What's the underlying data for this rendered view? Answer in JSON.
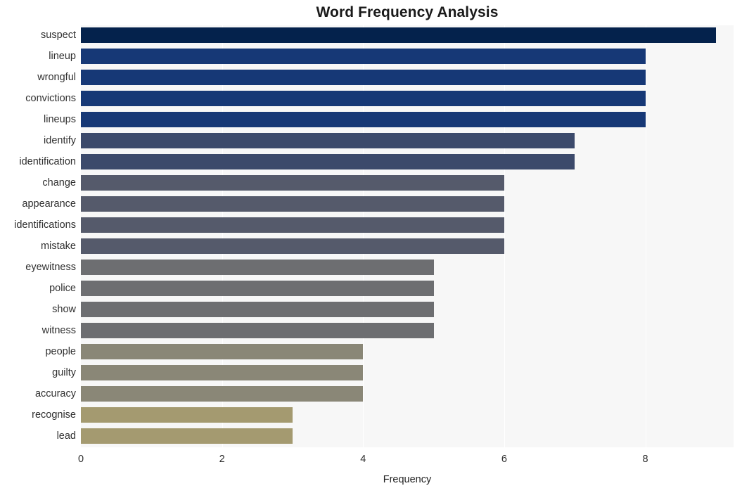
{
  "chart_data": {
    "type": "bar",
    "orientation": "horizontal",
    "title": "Word Frequency Analysis",
    "xlabel": "Frequency",
    "ylabel": "",
    "xlim": [
      0,
      9.25
    ],
    "xticks": [
      0,
      2,
      4,
      6,
      8
    ],
    "xticklabels": [
      "0",
      "2",
      "4",
      "6",
      "8"
    ],
    "grid": "vertical-only",
    "legend": "none",
    "categories": [
      "suspect",
      "lineup",
      "wrongful",
      "convictions",
      "lineups",
      "identify",
      "identification",
      "change",
      "appearance",
      "identifications",
      "mistake",
      "eyewitness",
      "police",
      "show",
      "witness",
      "people",
      "guilty",
      "accuracy",
      "recognise",
      "lead"
    ],
    "values": [
      9,
      8,
      8,
      8,
      8,
      7,
      7,
      6,
      6,
      6,
      6,
      5,
      5,
      5,
      5,
      4,
      4,
      4,
      3,
      3
    ],
    "bar_colors": [
      "#04224c",
      "#163876",
      "#163876",
      "#163876",
      "#163876",
      "#3c4a6b",
      "#3c4a6b",
      "#555a6b",
      "#555a6b",
      "#555a6b",
      "#555a6b",
      "#6d6e71",
      "#6d6e71",
      "#6d6e71",
      "#6d6e71",
      "#8a8777",
      "#8a8777",
      "#8a8777",
      "#a49a70",
      "#a49a70"
    ],
    "colors": {
      "plot_background": "#f7f7f7",
      "figure_background": "#ffffff",
      "gridline": "#ffffff",
      "tick_label": "#303030",
      "title": "#1a1a1a"
    }
  }
}
